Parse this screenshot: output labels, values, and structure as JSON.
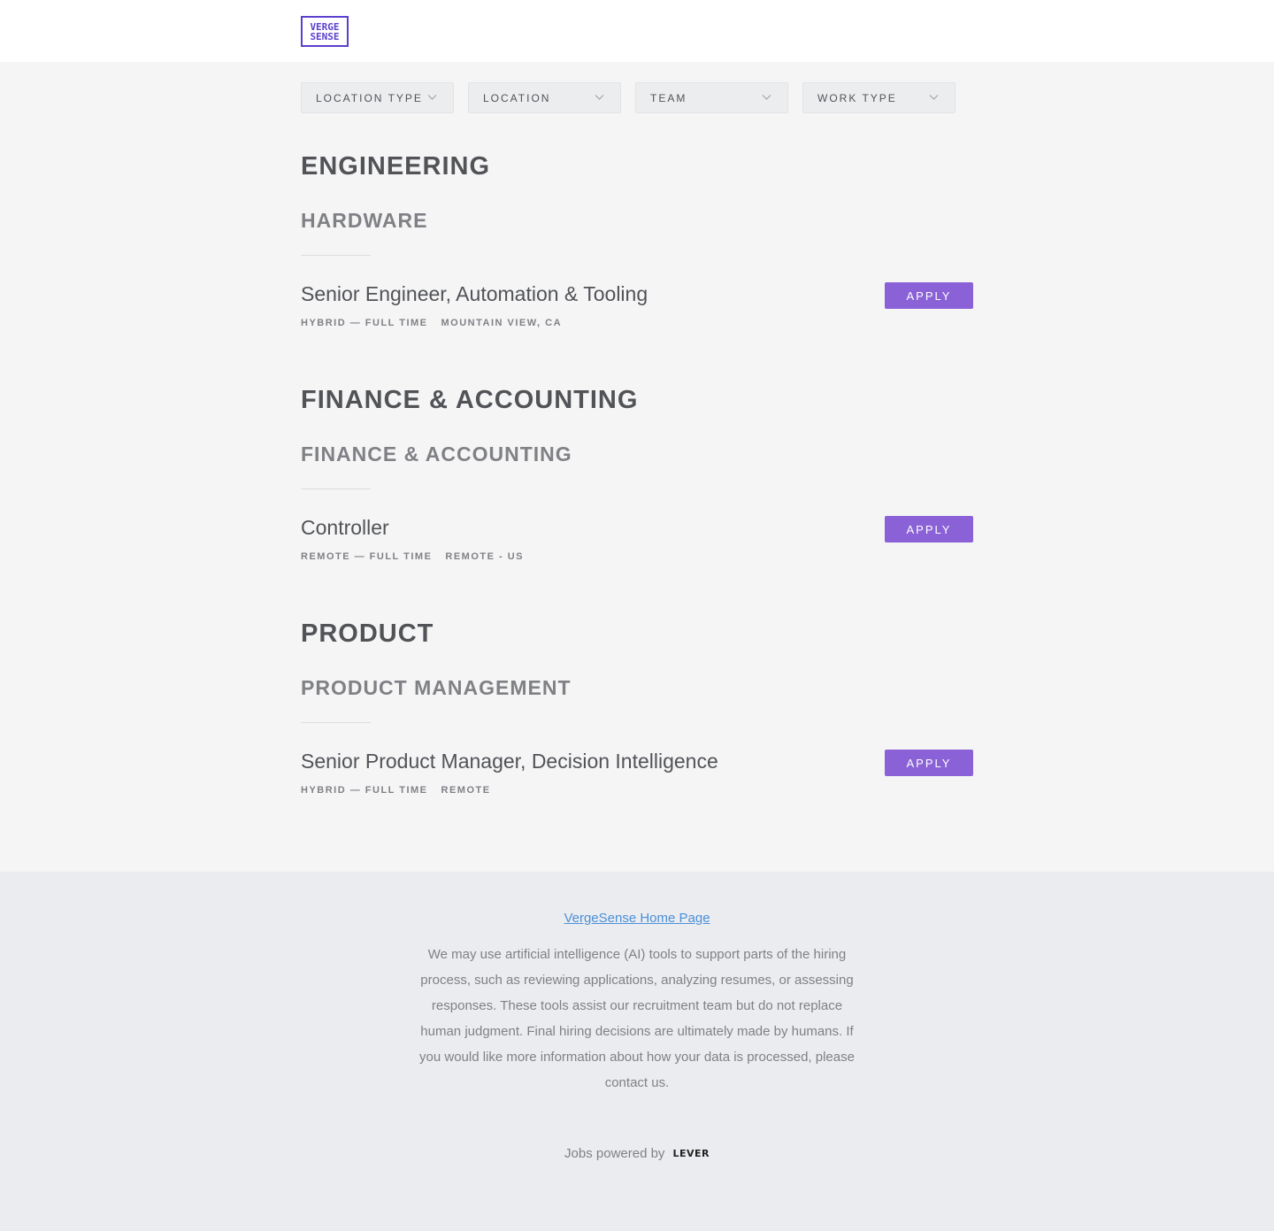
{
  "header": {
    "logo_line1": "VERGE",
    "logo_line2": "SENSE"
  },
  "filters": [
    {
      "label": "LOCATION TYPE"
    },
    {
      "label": "LOCATION"
    },
    {
      "label": "TEAM"
    },
    {
      "label": "WORK TYPE"
    }
  ],
  "sections": [
    {
      "department": "ENGINEERING",
      "team": "HARDWARE",
      "posting": {
        "title": "Senior Engineer, Automation & Tooling",
        "commitment": "HYBRID — FULL TIME",
        "location": "MOUNTAIN VIEW, CA",
        "apply_label": "APPLY"
      }
    },
    {
      "department": "FINANCE & ACCOUNTING",
      "team": "FINANCE & ACCOUNTING",
      "posting": {
        "title": "Controller",
        "commitment": "REMOTE — FULL TIME",
        "location": "REMOTE - US",
        "apply_label": "APPLY"
      }
    },
    {
      "department": "PRODUCT",
      "team": "PRODUCT MANAGEMENT",
      "posting": {
        "title": "Senior Product Manager, Decision Intelligence",
        "commitment": "HYBRID — FULL TIME",
        "location": "REMOTE",
        "apply_label": "APPLY"
      }
    }
  ],
  "footer": {
    "home_link": "VergeSense Home Page",
    "ai_notice": "We may use artificial intelligence (AI) tools to support parts of the hiring process, such as reviewing applications, analyzing resumes, or assessing responses. These tools assist our recruitment team but do not replace human judgment. Final hiring decisions are ultimately made by humans. If you would like more information about how your data is processed, please contact us.",
    "powered_by": "Jobs powered by",
    "lever_logo": "LEVER"
  },
  "colors": {
    "brand": "#5b3fcf",
    "apply_button": "#8a61d6",
    "link": "#4a90d9"
  }
}
